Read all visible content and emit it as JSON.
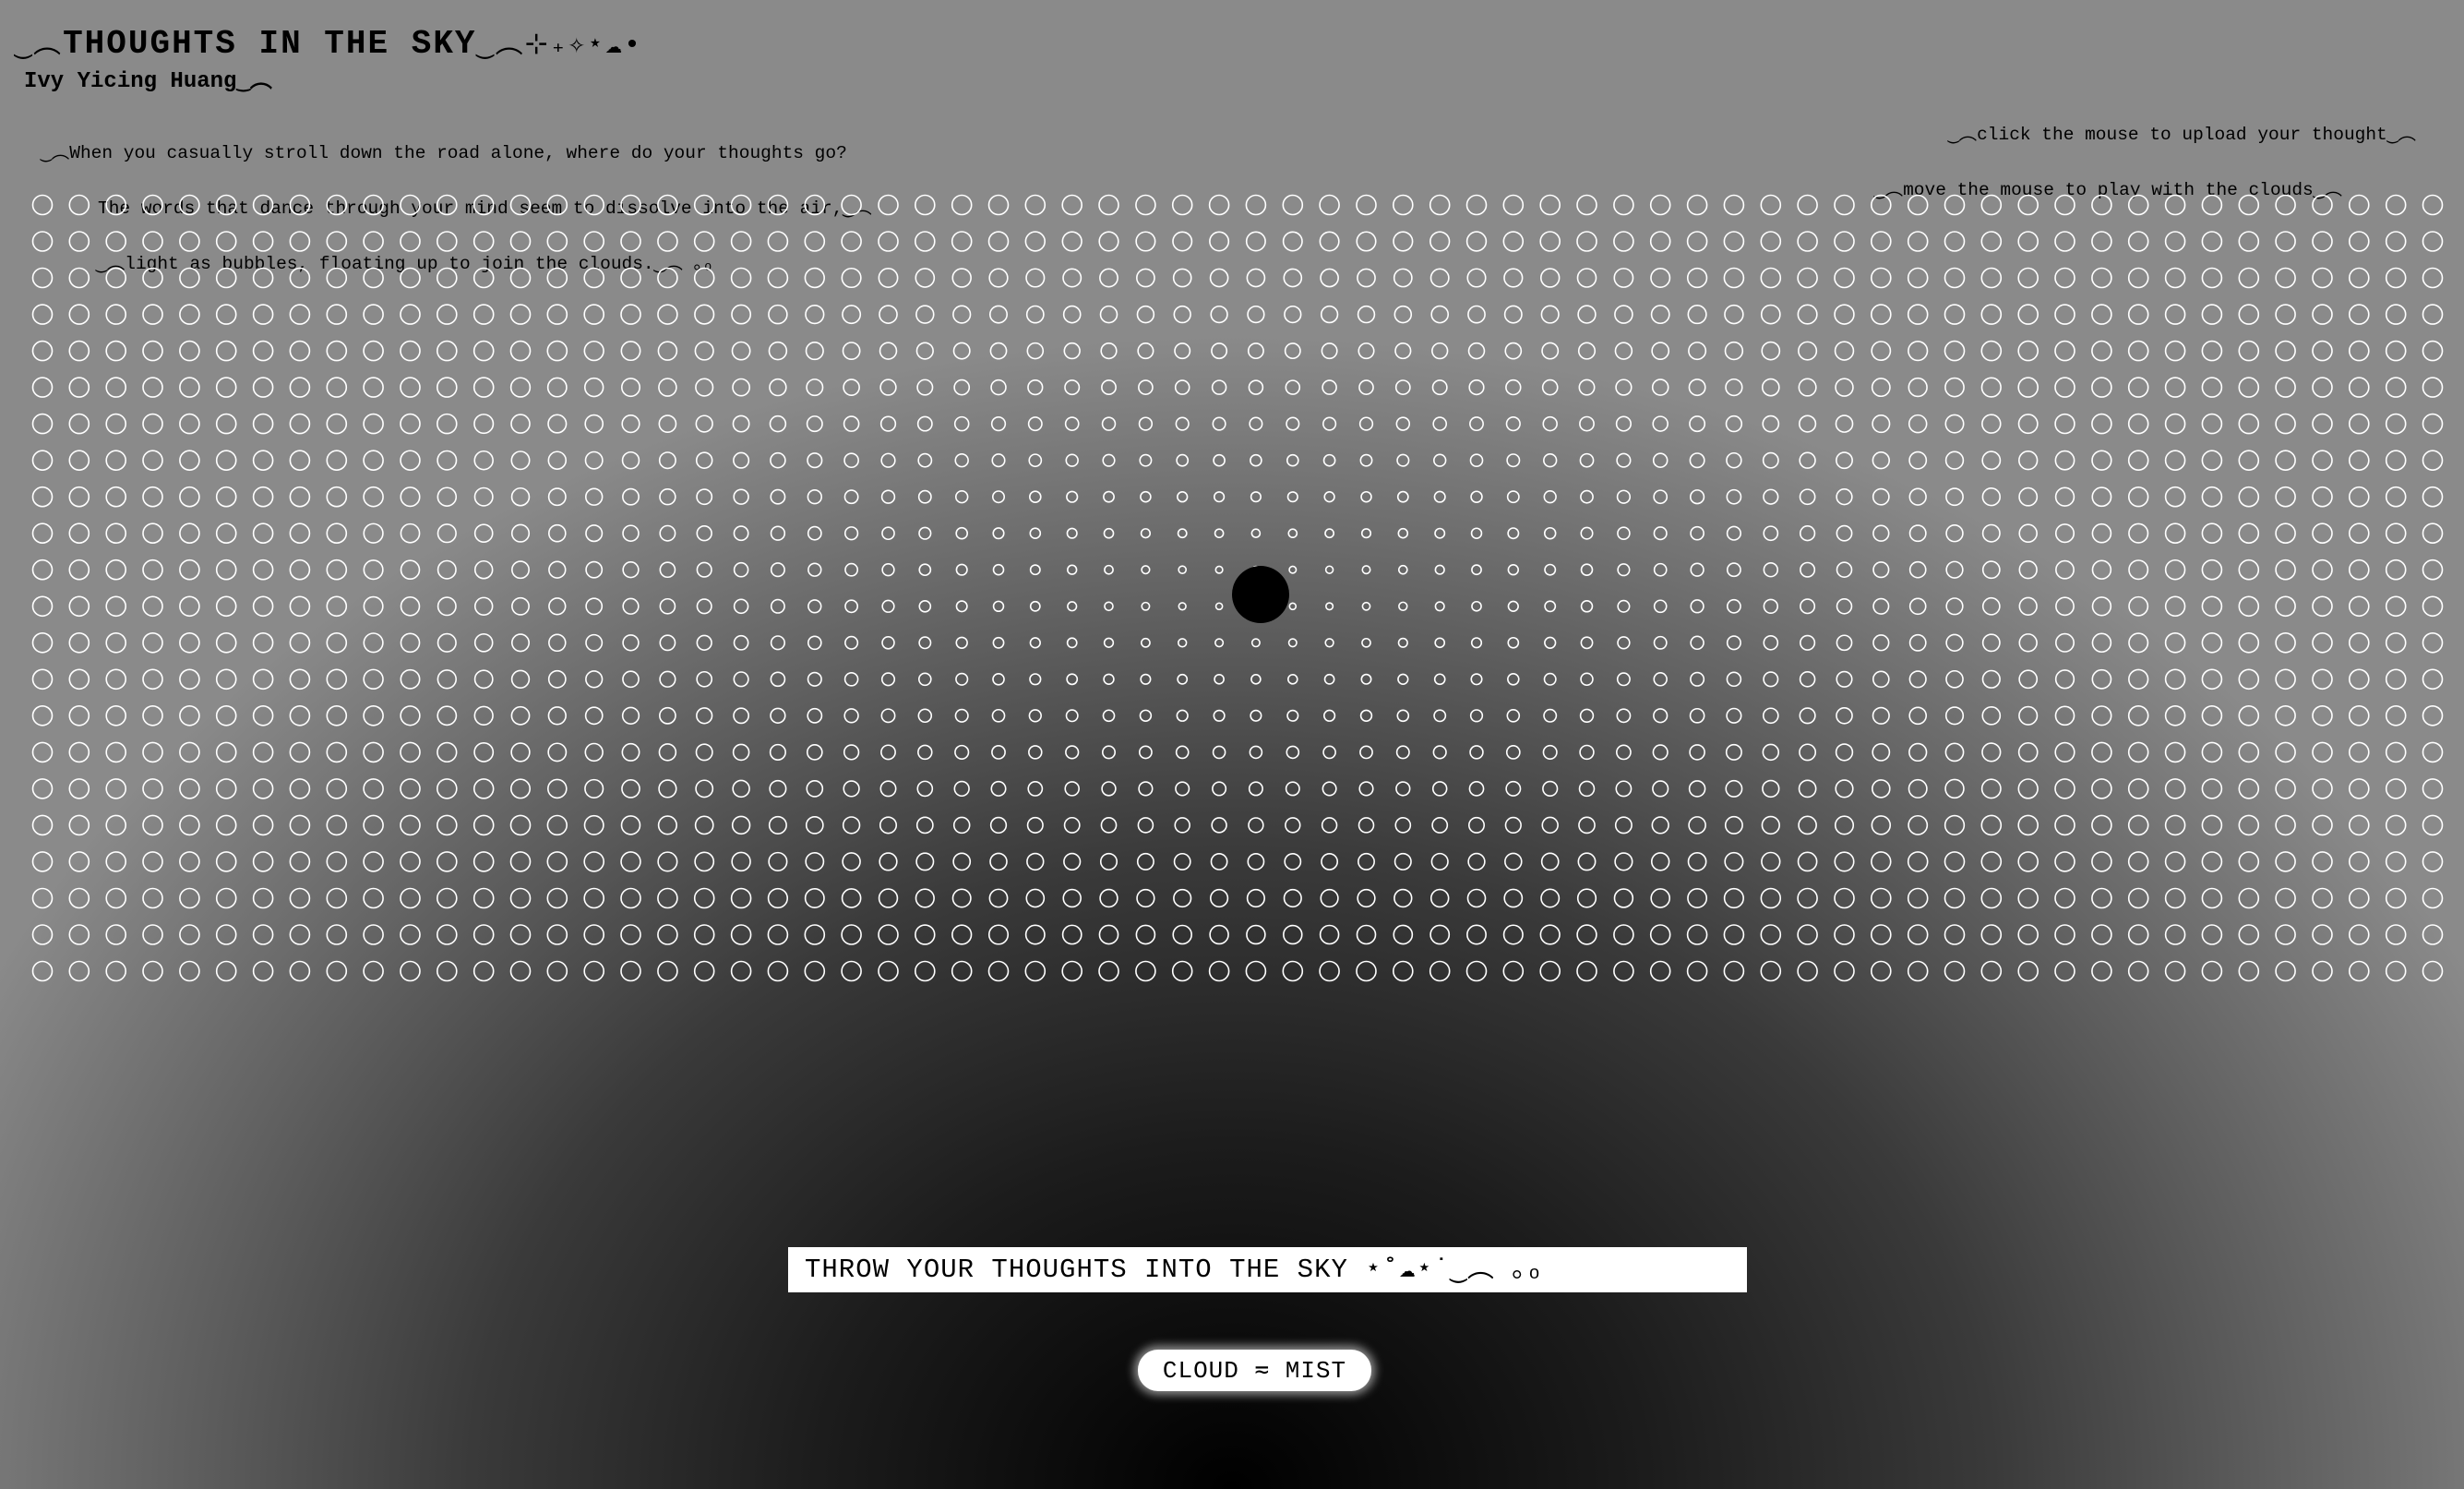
{
  "header": {
    "title": "THOUGHTS IN THE SKY",
    "title_prefix": "‿︵",
    "title_suffix": "‿︵⊹₊✧⋆☁︎•",
    "author": "Ivy Yicing Huang",
    "author_suffix": "‿︵"
  },
  "intro": {
    "lines": [
      "‿︵When you casually stroll down the road alone, where do your thoughts go?",
      "The words that dance through your mind seem to dissolve into the air,‿︵",
      "‿︵light as bubbles, floating up to join the clouds.‿︵ ｡ₒ"
    ]
  },
  "instructions": {
    "lines": [
      "‿︵click the mouse to upload your thought‿︵",
      "‿︵move the mouse to play with the clouds‿︵"
    ]
  },
  "bubbles": {
    "rows": 22,
    "cols": 66,
    "stroke_color": "#ffffff",
    "cursor_color": "#000000"
  },
  "input": {
    "placeholder": "THROW YOUR THOUGHTS INTO THE SKY ⋆˚☁︎⋆˙‿︵ ｡ₒ",
    "value": ""
  },
  "mode_button": {
    "label": "CLOUD ≂ MIST"
  }
}
